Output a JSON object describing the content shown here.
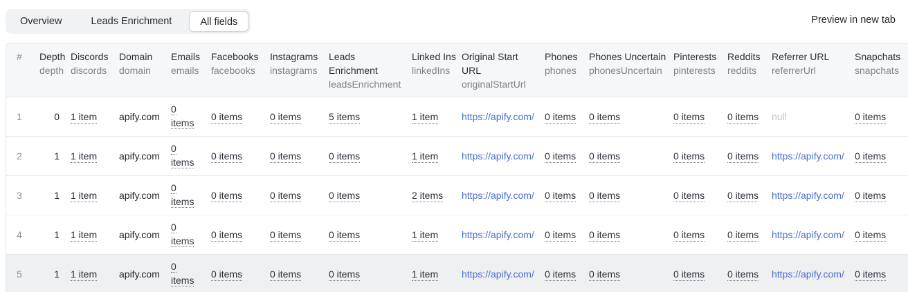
{
  "tabs": [
    {
      "label": "Overview",
      "active": false
    },
    {
      "label": "Leads Enrichment",
      "active": false
    },
    {
      "label": "All fields",
      "active": true
    }
  ],
  "preview_label": "Preview in new tab",
  "table": {
    "hash_header": "#",
    "columns": [
      {
        "label": "Depth",
        "key": "depth"
      },
      {
        "label": "Discords",
        "key": "discords"
      },
      {
        "label": "Domain",
        "key": "domain"
      },
      {
        "label": "Emails",
        "key": "emails"
      },
      {
        "label": "Facebooks",
        "key": "facebooks"
      },
      {
        "label": "Instagrams",
        "key": "instagrams"
      },
      {
        "label": "Leads Enrichment",
        "key": "leadsEnrichment"
      },
      {
        "label": "Linked Ins",
        "key": "linkedIns"
      },
      {
        "label": "Original Start URL",
        "key": "originalStartUrl"
      },
      {
        "label": "Phones",
        "key": "phones"
      },
      {
        "label": "Phones Uncertain",
        "key": "phonesUncertain"
      },
      {
        "label": "Pinterests",
        "key": "pinterests"
      },
      {
        "label": "Reddits",
        "key": "reddits"
      },
      {
        "label": "Referrer URL",
        "key": "referrerUrl"
      },
      {
        "label": "Snapchats",
        "key": "snapchats"
      }
    ],
    "rows": [
      {
        "index": "1",
        "depth": "0",
        "discords": "1 item",
        "domain": "apify.com",
        "emails_count": "0",
        "emails_unit": "items",
        "facebooks": "0 items",
        "instagrams": "0 items",
        "leadsEnrichment": "5 items",
        "linkedIns": "1 item",
        "originalStartUrl": "https://apify.com/",
        "phones": "0 items",
        "phonesUncertain": "0 items",
        "pinterests": "0 items",
        "reddits": "0 items",
        "referrerUrl": "null",
        "snapchats": "0 items"
      },
      {
        "index": "2",
        "depth": "1",
        "discords": "1 item",
        "domain": "apify.com",
        "emails_count": "0",
        "emails_unit": "items",
        "facebooks": "0 items",
        "instagrams": "0 items",
        "leadsEnrichment": "0 items",
        "linkedIns": "1 item",
        "originalStartUrl": "https://apify.com/",
        "phones": "0 items",
        "phonesUncertain": "0 items",
        "pinterests": "0 items",
        "reddits": "0 items",
        "referrerUrl": "https://apify.com/",
        "snapchats": "0 items"
      },
      {
        "index": "3",
        "depth": "1",
        "discords": "1 item",
        "domain": "apify.com",
        "emails_count": "0",
        "emails_unit": "items",
        "facebooks": "0 items",
        "instagrams": "0 items",
        "leadsEnrichment": "0 items",
        "linkedIns": "2 items",
        "originalStartUrl": "https://apify.com/",
        "phones": "0 items",
        "phonesUncertain": "0 items",
        "pinterests": "0 items",
        "reddits": "0 items",
        "referrerUrl": "https://apify.com/",
        "snapchats": "0 items"
      },
      {
        "index": "4",
        "depth": "1",
        "discords": "1 item",
        "domain": "apify.com",
        "emails_count": "0",
        "emails_unit": "items",
        "facebooks": "0 items",
        "instagrams": "0 items",
        "leadsEnrichment": "0 items",
        "linkedIns": "1 item",
        "originalStartUrl": "https://apify.com/",
        "phones": "0 items",
        "phonesUncertain": "0 items",
        "pinterests": "0 items",
        "reddits": "0 items",
        "referrerUrl": "https://apify.com/",
        "snapchats": "0 items"
      },
      {
        "index": "5",
        "depth": "1",
        "discords": "1 item",
        "domain": "apify.com",
        "emails_count": "0",
        "emails_unit": "items",
        "facebooks": "0 items",
        "instagrams": "0 items",
        "leadsEnrichment": "0 items",
        "linkedIns": "1 item",
        "originalStartUrl": "https://apify.com/",
        "phones": "0 items",
        "phonesUncertain": "0 items",
        "pinterests": "0 items",
        "reddits": "0 items",
        "referrerUrl": "https://apify.com/",
        "snapchats": "0 items"
      }
    ]
  },
  "colors": {
    "link": "#4a6fd1",
    "null_text": "#c2c6cb",
    "header_bg": "#f6f7f8",
    "hover_row_bg": "#eef0f2"
  }
}
